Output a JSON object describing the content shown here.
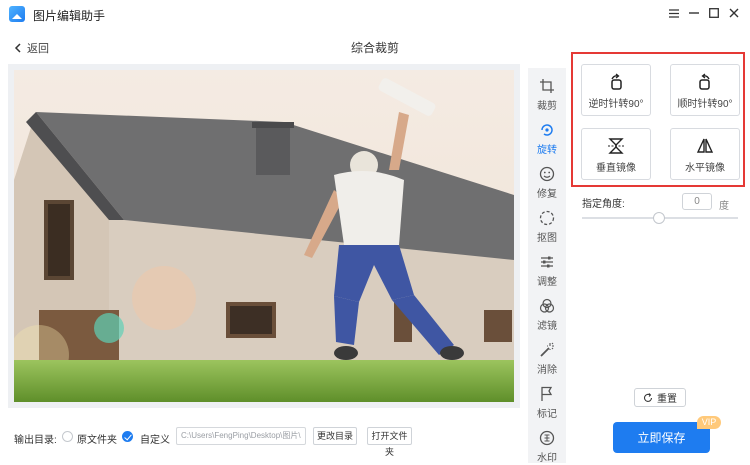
{
  "app": {
    "title": "图片编辑助手"
  },
  "header": {
    "back_label": "返回",
    "page_title": "综合裁剪"
  },
  "sidebar": {
    "tools": [
      {
        "label": "裁剪",
        "icon": "crop-icon"
      },
      {
        "label": "旋转",
        "icon": "rotate-icon",
        "active": true
      },
      {
        "label": "修复",
        "icon": "smile-icon"
      },
      {
        "label": "抠图",
        "icon": "cutout-icon"
      },
      {
        "label": "调整",
        "icon": "adjust-icon"
      },
      {
        "label": "滤镜",
        "icon": "filter-icon"
      },
      {
        "label": "消除",
        "icon": "magic-wand-icon"
      },
      {
        "label": "标记",
        "icon": "flag-icon"
      },
      {
        "label": "水印",
        "icon": "watermark-icon"
      }
    ]
  },
  "rotate_panel": {
    "ccw_label": "逆时针转90°",
    "cw_label": "顺时针转90°",
    "vflip_label": "垂直镜像",
    "hflip_label": "水平镜像",
    "angle_label": "指定角度:",
    "angle_value": "0",
    "angle_unit": "度"
  },
  "actions": {
    "reset_label": "重置",
    "save_label": "立即保存",
    "vip_badge": "VIP"
  },
  "footer": {
    "output_label": "输出目录:",
    "option_original": "原文件夹",
    "option_custom": "自定义",
    "custom_selected": true,
    "path_value": "C:\\Users\\FengPing\\Desktop\\图片\\",
    "change_dir_label": "更改目录",
    "open_folder_label": "打开文件夹"
  },
  "colors": {
    "accent": "#1e7cf0",
    "highlight_border": "#e53935",
    "vip": "#ffc97a"
  }
}
